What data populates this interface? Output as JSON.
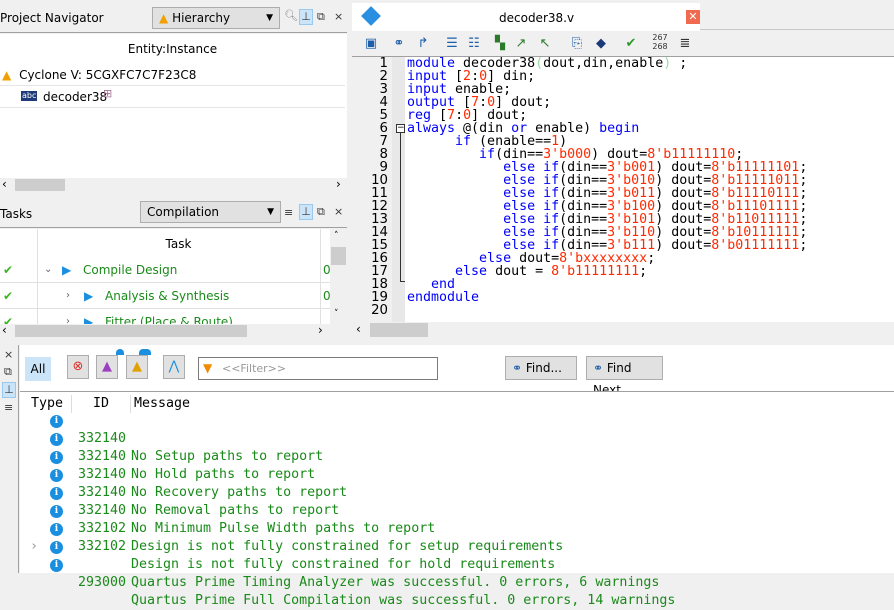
{
  "project_navigator": {
    "title": "Project Navigator",
    "view": "Hierarchy",
    "column": "Entity:Instance",
    "device": "Cyclone V: 5CGXFC7C7F23C8",
    "top_entity": "decoder38"
  },
  "tasks": {
    "title": "Tasks",
    "flow": "Compilation",
    "column": "Task",
    "rows": [
      {
        "label": "Compile Design",
        "status": "done",
        "expanded": true,
        "col2": "0"
      },
      {
        "label": "Analysis & Synthesis",
        "status": "done",
        "expanded": false,
        "col2": "0"
      },
      {
        "label": "Fitter (Place & Route)",
        "status": "done",
        "expanded": false,
        "col2": ""
      }
    ]
  },
  "editor": {
    "tab": "decoder38.v",
    "line_counter": [
      "267",
      "268"
    ],
    "lines": [
      [
        {
          "t": "module",
          "c": "kw"
        },
        {
          "t": " decoder38",
          "c": "txt"
        },
        {
          "t": "(",
          "c": "par"
        },
        {
          "t": "dout,din,enable",
          "c": "txt"
        },
        {
          "t": ")",
          "c": "par"
        },
        {
          "t": " ;",
          "c": "txt"
        }
      ],
      [
        {
          "t": "input",
          "c": "kw"
        },
        {
          "t": " [",
          "c": "txt"
        },
        {
          "t": "2",
          "c": "num"
        },
        {
          "t": ":",
          "c": "txt"
        },
        {
          "t": "0",
          "c": "num"
        },
        {
          "t": "] din;",
          "c": "txt"
        }
      ],
      [
        {
          "t": "input",
          "c": "kw"
        },
        {
          "t": " enable;",
          "c": "txt"
        }
      ],
      [
        {
          "t": "output",
          "c": "kw"
        },
        {
          "t": " [",
          "c": "txt"
        },
        {
          "t": "7",
          "c": "num"
        },
        {
          "t": ":",
          "c": "txt"
        },
        {
          "t": "0",
          "c": "num"
        },
        {
          "t": "] dout;",
          "c": "txt"
        }
      ],
      [
        {
          "t": "reg",
          "c": "kw"
        },
        {
          "t": " [",
          "c": "txt"
        },
        {
          "t": "7",
          "c": "num"
        },
        {
          "t": ":",
          "c": "txt"
        },
        {
          "t": "0",
          "c": "num"
        },
        {
          "t": "] dout;",
          "c": "txt"
        }
      ],
      [
        {
          "t": "always",
          "c": "kw"
        },
        {
          "t": " @(din ",
          "c": "txt"
        },
        {
          "t": "or",
          "c": "kw"
        },
        {
          "t": " enable) ",
          "c": "txt"
        },
        {
          "t": "begin",
          "c": "kw"
        }
      ],
      [
        {
          "t": "      if",
          "c": "kw"
        },
        {
          "t": " (enable==",
          "c": "txt"
        },
        {
          "t": "1",
          "c": "num"
        },
        {
          "t": ")",
          "c": "txt"
        }
      ],
      [
        {
          "t": "         if",
          "c": "kw"
        },
        {
          "t": "(din==",
          "c": "txt"
        },
        {
          "t": "3'b000",
          "c": "num"
        },
        {
          "t": ") dout=",
          "c": "txt"
        },
        {
          "t": "8'b11111110",
          "c": "num"
        },
        {
          "t": ";",
          "c": "txt"
        }
      ],
      [
        {
          "t": "            else if",
          "c": "kw"
        },
        {
          "t": "(din==",
          "c": "txt"
        },
        {
          "t": "3'b001",
          "c": "num"
        },
        {
          "t": ") dout=",
          "c": "txt"
        },
        {
          "t": "8'b11111101",
          "c": "num"
        },
        {
          "t": ";",
          "c": "txt"
        }
      ],
      [
        {
          "t": "            else if",
          "c": "kw"
        },
        {
          "t": "(din==",
          "c": "txt"
        },
        {
          "t": "3'b010",
          "c": "num"
        },
        {
          "t": ") dout=",
          "c": "txt"
        },
        {
          "t": "8'b11111011",
          "c": "num"
        },
        {
          "t": ";",
          "c": "txt"
        }
      ],
      [
        {
          "t": "            else if",
          "c": "kw"
        },
        {
          "t": "(din==",
          "c": "txt"
        },
        {
          "t": "3'b011",
          "c": "num"
        },
        {
          "t": ") dout=",
          "c": "txt"
        },
        {
          "t": "8'b11110111",
          "c": "num"
        },
        {
          "t": ";",
          "c": "txt"
        }
      ],
      [
        {
          "t": "            else if",
          "c": "kw"
        },
        {
          "t": "(din==",
          "c": "txt"
        },
        {
          "t": "3'b100",
          "c": "num"
        },
        {
          "t": ") dout=",
          "c": "txt"
        },
        {
          "t": "8'b11101111",
          "c": "num"
        },
        {
          "t": ";",
          "c": "txt"
        }
      ],
      [
        {
          "t": "            else if",
          "c": "kw"
        },
        {
          "t": "(din==",
          "c": "txt"
        },
        {
          "t": "3'b101",
          "c": "num"
        },
        {
          "t": ") dout=",
          "c": "txt"
        },
        {
          "t": "8'b11011111",
          "c": "num"
        },
        {
          "t": ";",
          "c": "txt"
        }
      ],
      [
        {
          "t": "            else if",
          "c": "kw"
        },
        {
          "t": "(din==",
          "c": "txt"
        },
        {
          "t": "3'b110",
          "c": "num"
        },
        {
          "t": ") dout=",
          "c": "txt"
        },
        {
          "t": "8'b10111111",
          "c": "num"
        },
        {
          "t": ";",
          "c": "txt"
        }
      ],
      [
        {
          "t": "            else if",
          "c": "kw"
        },
        {
          "t": "(din==",
          "c": "txt"
        },
        {
          "t": "3'b111",
          "c": "num"
        },
        {
          "t": ") dout=",
          "c": "txt"
        },
        {
          "t": "8'b01111111",
          "c": "num"
        },
        {
          "t": ";",
          "c": "txt"
        }
      ],
      [
        {
          "t": "         else",
          "c": "kw"
        },
        {
          "t": " dout=",
          "c": "txt"
        },
        {
          "t": "8'bxxxxxxxx",
          "c": "num"
        },
        {
          "t": ";",
          "c": "txt"
        }
      ],
      [
        {
          "t": "      else",
          "c": "kw"
        },
        {
          "t": " dout = ",
          "c": "txt"
        },
        {
          "t": "8'b11111111",
          "c": "num"
        },
        {
          "t": ";",
          "c": "txt"
        }
      ],
      [
        {
          "t": "   end",
          "c": "kw"
        }
      ],
      [
        {
          "t": "endmodule",
          "c": "kw"
        }
      ],
      []
    ]
  },
  "messages": {
    "all_label": "All",
    "filter_placeholder": "<<Filter>>",
    "find_label": "Find...",
    "find_next_label": "Find Next",
    "columns": [
      "Type",
      "ID",
      "Message"
    ],
    "rows": [
      {
        "id": "332140",
        "text": "No Setup paths to report"
      },
      {
        "id": "332140",
        "text": "No Hold paths to report"
      },
      {
        "id": "332140",
        "text": "No Recovery paths to report"
      },
      {
        "id": "332140",
        "text": "No Removal paths to report"
      },
      {
        "id": "332140",
        "text": "No Minimum Pulse Width paths to report"
      },
      {
        "id": "332102",
        "text": "Design is not fully constrained for setup requirements"
      },
      {
        "id": "332102",
        "text": "Design is not fully constrained for hold requirements"
      },
      {
        "id": "",
        "text": "Quartus Prime Timing Analyzer was successful. 0 errors, 6 warnings",
        "expandable": true
      },
      {
        "id": "293000",
        "text": "Quartus Prime Full Compilation was successful. 0 errors, 14 warnings"
      }
    ]
  },
  "colors": {
    "keyword": "#0000ff",
    "number": "#ff2a00",
    "message": "#1a8a1a",
    "success": "#3cb521",
    "task_play": "#1a8fe0"
  }
}
